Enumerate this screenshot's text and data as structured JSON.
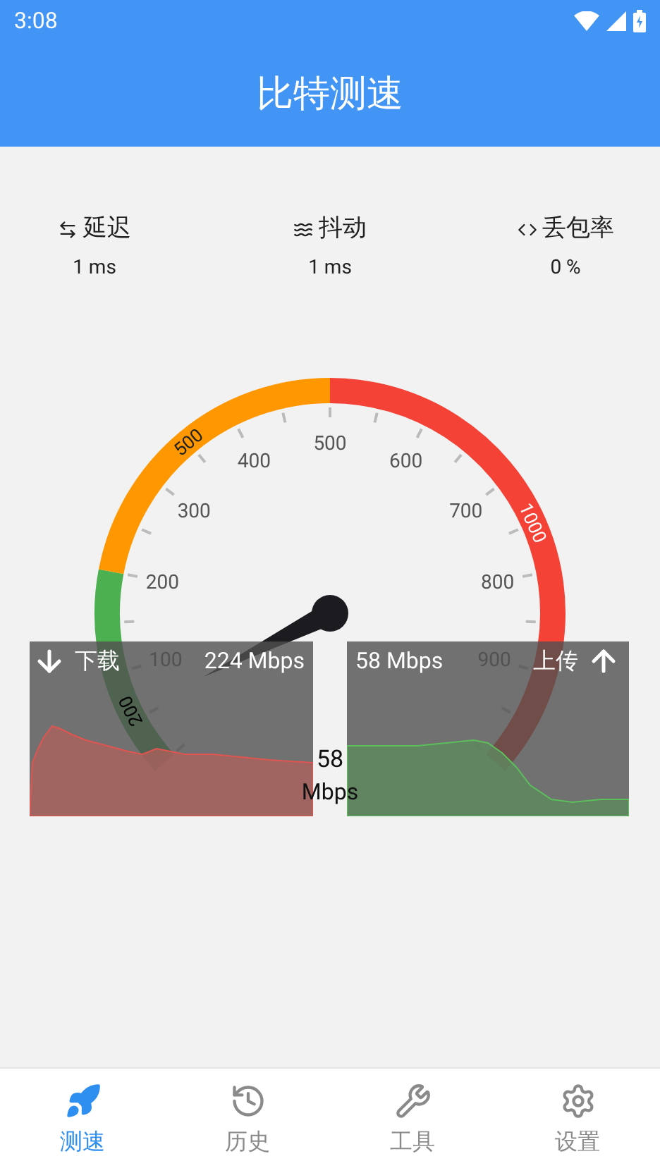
{
  "status_bar": {
    "time": "3:08"
  },
  "header": {
    "title": "比特测速"
  },
  "metrics": [
    {
      "kind": "latency",
      "label": "延迟",
      "value": "1 ms"
    },
    {
      "kind": "jitter",
      "label": "抖动",
      "value": "1 ms"
    },
    {
      "kind": "loss",
      "label": "丢包率",
      "value": "0 %"
    }
  ],
  "gauge": {
    "segments": [
      {
        "label": "200",
        "color": "#4caf50"
      },
      {
        "label": "500",
        "color": "#ff9800"
      },
      {
        "label": "1000",
        "color": "#f44336"
      }
    ],
    "tick_labels": [
      "100",
      "200",
      "300",
      "400",
      "500",
      "600",
      "700",
      "800",
      "900"
    ],
    "reading": "58",
    "unit": "Mbps"
  },
  "download": {
    "label": "下载",
    "speed": "224 Mbps"
  },
  "upload": {
    "label": "上传",
    "speed": "58 Mbps"
  },
  "tabs": [
    {
      "kind": "speed",
      "label": "测速",
      "selected": true
    },
    {
      "kind": "history",
      "label": "历史",
      "selected": false
    },
    {
      "kind": "tools",
      "label": "工具",
      "selected": false
    },
    {
      "kind": "settings",
      "label": "设置",
      "selected": false
    }
  ]
}
